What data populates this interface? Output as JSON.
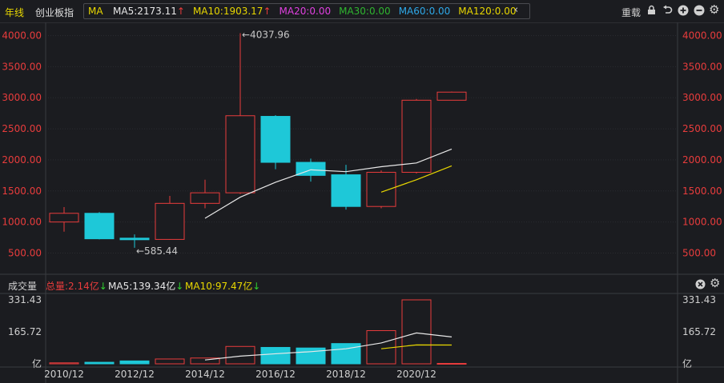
{
  "header": {
    "period": "年线",
    "index_name": "创业板指",
    "ma_label": "MA",
    "ma_items": [
      {
        "text": "MA5:2173.11",
        "arrow": "↑",
        "color": "#e8e8e8"
      },
      {
        "text": "MA10:1903.17",
        "arrow": "↑",
        "color": "#e8d700"
      },
      {
        "text": "MA20:0.00",
        "arrow": "",
        "color": "#e040e0"
      },
      {
        "text": "MA30:0.00",
        "arrow": "",
        "color": "#2fb52f"
      },
      {
        "text": "MA60:0.00",
        "arrow": "",
        "color": "#2ea8e8"
      },
      {
        "text": "MA120:0.00",
        "arrow": "",
        "color": "#e8d700"
      }
    ],
    "collapse_icon": "chevron-left-icon",
    "restore_label": "重载",
    "icons": [
      "lock-icon",
      "undo-icon",
      "zoom-in-icon",
      "zoom-out-icon",
      "settings-icon"
    ]
  },
  "volume_header": {
    "label": "成交量",
    "total": "总量:2.14亿",
    "total_arrow": "↓",
    "ma5": "MA5:139.34亿",
    "ma5_arrow": "↓",
    "ma10": "MA10:97.47亿",
    "ma10_arrow": "↓",
    "icons": [
      "close-icon",
      "settings-icon"
    ]
  },
  "colors": {
    "up": "#e83c3c",
    "down": "#1ec8d8",
    "ma5": "#e8e8e8",
    "ma10": "#e8d700",
    "axis_text": "#e83c3c",
    "annotation": "#c8c8c8"
  },
  "chart_data": [
    {
      "type": "candlestick",
      "title": "创业板指 年线",
      "ylim": [
        300,
        4350
      ],
      "y_ticks": [
        "500.00",
        "1000.00",
        "1500.00",
        "2000.00",
        "2500.00",
        "3000.00",
        "3500.00",
        "4000.00"
      ],
      "annotations": [
        {
          "text": "←4037.96",
          "x": "2015",
          "y": 4037.96
        },
        {
          "text": "←585.44",
          "x": "2012",
          "y": 585.44
        }
      ],
      "candles": [
        {
          "x": "2010",
          "open": 1000,
          "close": 1140,
          "high": 1240,
          "low": 845
        },
        {
          "x": "2011",
          "open": 1140,
          "close": 730,
          "high": 1160,
          "low": 720
        },
        {
          "x": "2012",
          "open": 740,
          "close": 715,
          "high": 800,
          "low": 585.44
        },
        {
          "x": "2013",
          "open": 720,
          "close": 1300,
          "high": 1420,
          "low": 715
        },
        {
          "x": "2014",
          "open": 1300,
          "close": 1470,
          "high": 1680,
          "low": 1220
        },
        {
          "x": "2015",
          "open": 1470,
          "close": 2710,
          "high": 4037.96,
          "low": 1450
        },
        {
          "x": "2016",
          "open": 2700,
          "close": 1960,
          "high": 2720,
          "low": 1850
        },
        {
          "x": "2017",
          "open": 1960,
          "close": 1750,
          "high": 2020,
          "low": 1650
        },
        {
          "x": "2018",
          "open": 1760,
          "close": 1250,
          "high": 1920,
          "low": 1200
        },
        {
          "x": "2019",
          "open": 1250,
          "close": 1800,
          "high": 1830,
          "low": 1220
        },
        {
          "x": "2020",
          "open": 1800,
          "close": 2960,
          "high": 2980,
          "low": 1780
        },
        {
          "x": "2021",
          "open": 2960,
          "close": 3090,
          "high": 3100,
          "low": 2960
        }
      ],
      "series": [
        {
          "name": "MA5",
          "x": [
            "2014",
            "2015",
            "2016",
            "2017",
            "2018",
            "2019",
            "2020",
            "2021"
          ],
          "values": [
            1060,
            1400,
            1640,
            1840,
            1810,
            1890,
            1950,
            2173.11
          ]
        },
        {
          "name": "MA10",
          "x": [
            "2019",
            "2020",
            "2021"
          ],
          "values": [
            1480,
            1680,
            1903.17
          ]
        }
      ]
    },
    {
      "type": "bar",
      "title": "成交量",
      "y_ticks": [
        "331.43",
        "165.72",
        "亿"
      ],
      "y_values": [
        331.43,
        165.72,
        0
      ],
      "ylim": [
        0,
        331.43
      ],
      "x_labels": [
        "2010/12",
        "2012/12",
        "2014/12",
        "2016/12",
        "2018/12",
        "2020/12"
      ],
      "categories": [
        "2010",
        "2011",
        "2012",
        "2013",
        "2014",
        "2015",
        "2016",
        "2017",
        "2018",
        "2019",
        "2020",
        "2021"
      ],
      "values": [
        5,
        8,
        15,
        25,
        30,
        90,
        85,
        82,
        105,
        172,
        331.43,
        2.14
      ],
      "directions": [
        "up",
        "down",
        "down",
        "up",
        "up",
        "up",
        "down",
        "down",
        "down",
        "up",
        "up",
        "up"
      ],
      "series": [
        {
          "name": "MA5",
          "x": [
            "2014",
            "2015",
            "2016",
            "2017",
            "2018",
            "2019",
            "2020",
            "2021"
          ],
          "values": [
            20,
            40,
            52,
            63,
            78,
            108,
            160,
            139.34
          ]
        },
        {
          "name": "MA10",
          "x": [
            "2019",
            "2020",
            "2021"
          ],
          "values": [
            78,
            98,
            97.47
          ]
        }
      ]
    }
  ]
}
